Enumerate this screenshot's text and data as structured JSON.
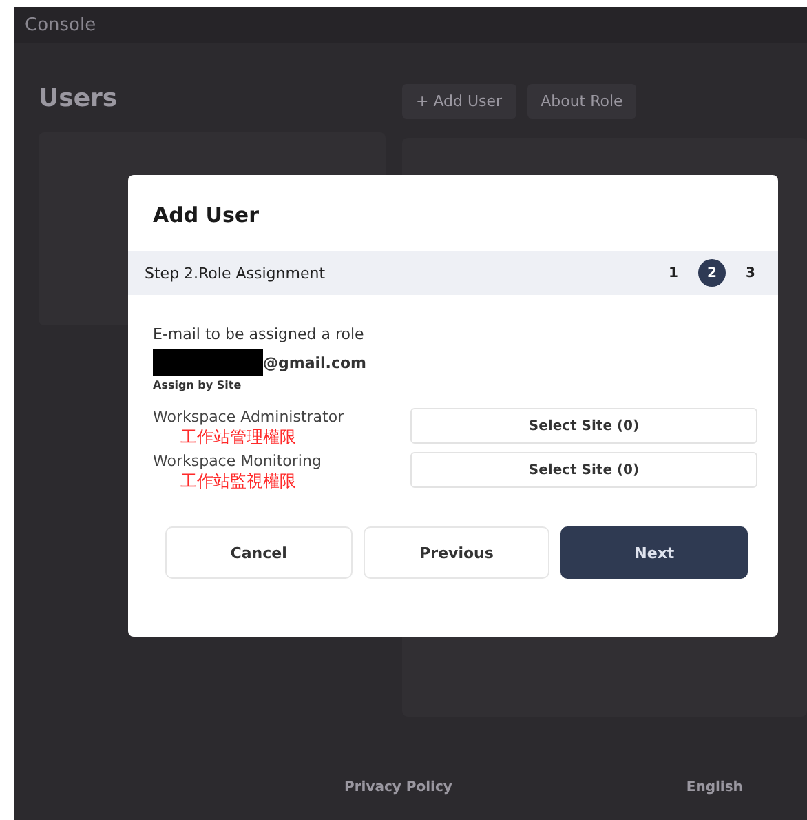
{
  "header": {
    "title": "Console"
  },
  "page": {
    "title": "Users",
    "actions": [
      "+ Add User",
      "About Role"
    ]
  },
  "dialog": {
    "title": "Add User",
    "step": {
      "label": "Step 2.Role Assignment",
      "steps": [
        {
          "label": "1",
          "selected": false
        },
        {
          "label": "2",
          "selected": true
        },
        {
          "label": "3",
          "selected": false
        }
      ]
    },
    "email_label": "E-mail to be assigned a role",
    "email": "@gmail.com",
    "assign_label": "Assign by Site",
    "roles": [
      {
        "name": "Workspace Administrator",
        "note": "工作站管理權限",
        "button": "Select Site (0)"
      },
      {
        "name": "Workspace Monitoring",
        "note": "工作站監視權限",
        "button": "Select Site (0)"
      }
    ],
    "buttons": [
      {
        "label": "Cancel",
        "kind": "secondary"
      },
      {
        "label": "Previous",
        "kind": "secondary"
      },
      {
        "label": "Next",
        "kind": "primary"
      }
    ]
  },
  "footer": {
    "links": [
      "Privacy Policy",
      "English"
    ]
  }
}
